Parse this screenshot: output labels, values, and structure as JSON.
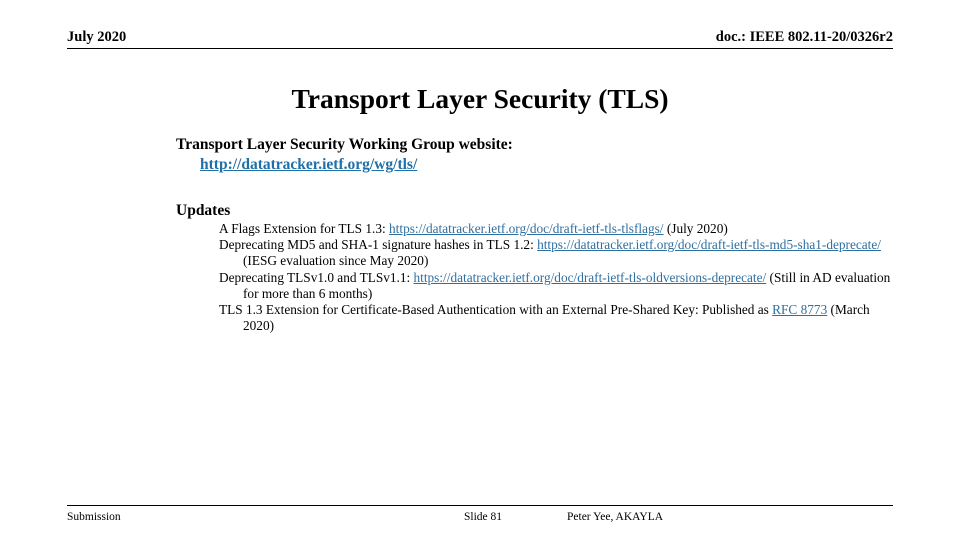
{
  "header": {
    "date": "July 2020",
    "doc_id": "doc.: IEEE 802.11-20/0326r2"
  },
  "title": "Transport Layer Security (TLS)",
  "body": {
    "wg_line": "Transport Layer Security Working Group website:",
    "wg_link_text": "http://datatracker.ietf.org/wg/tls/",
    "updates_heading": "Updates",
    "items": [
      {
        "prefix": "A Flags Extension for TLS 1.3: ",
        "link": "https://datatracker.ietf.org/doc/draft-ietf-tls-tlsflags/",
        "suffix": " (July 2020)"
      },
      {
        "prefix": "Deprecating MD5 and SHA-1 signature hashes in TLS 1.2: ",
        "link": "https://datatracker.ietf.org/doc/draft-ietf-tls-md5-sha1-deprecate/",
        "suffix": " (IESG evaluation since May 2020)"
      },
      {
        "prefix": "Deprecating TLSv1.0 and TLSv1.1: ",
        "link": "https://datatracker.ietf.org/doc/draft-ietf-tls-oldversions-deprecate/",
        "suffix": " (Still in AD evaluation for more than 6 months)"
      },
      {
        "prefix": "TLS 1.3 Extension for Certificate-Based Authentication with an External Pre-Shared Key: Published as ",
        "link": "RFC 8773",
        "suffix": " (March 2020)"
      }
    ]
  },
  "footer": {
    "left": "Submission",
    "center": "Slide 81",
    "right": "Peter Yee, AKAYLA"
  },
  "colors": {
    "link": "#2F6FA0",
    "link_strong": "#1F6FA8",
    "text": "#000000",
    "background": "#FFFFFF"
  }
}
